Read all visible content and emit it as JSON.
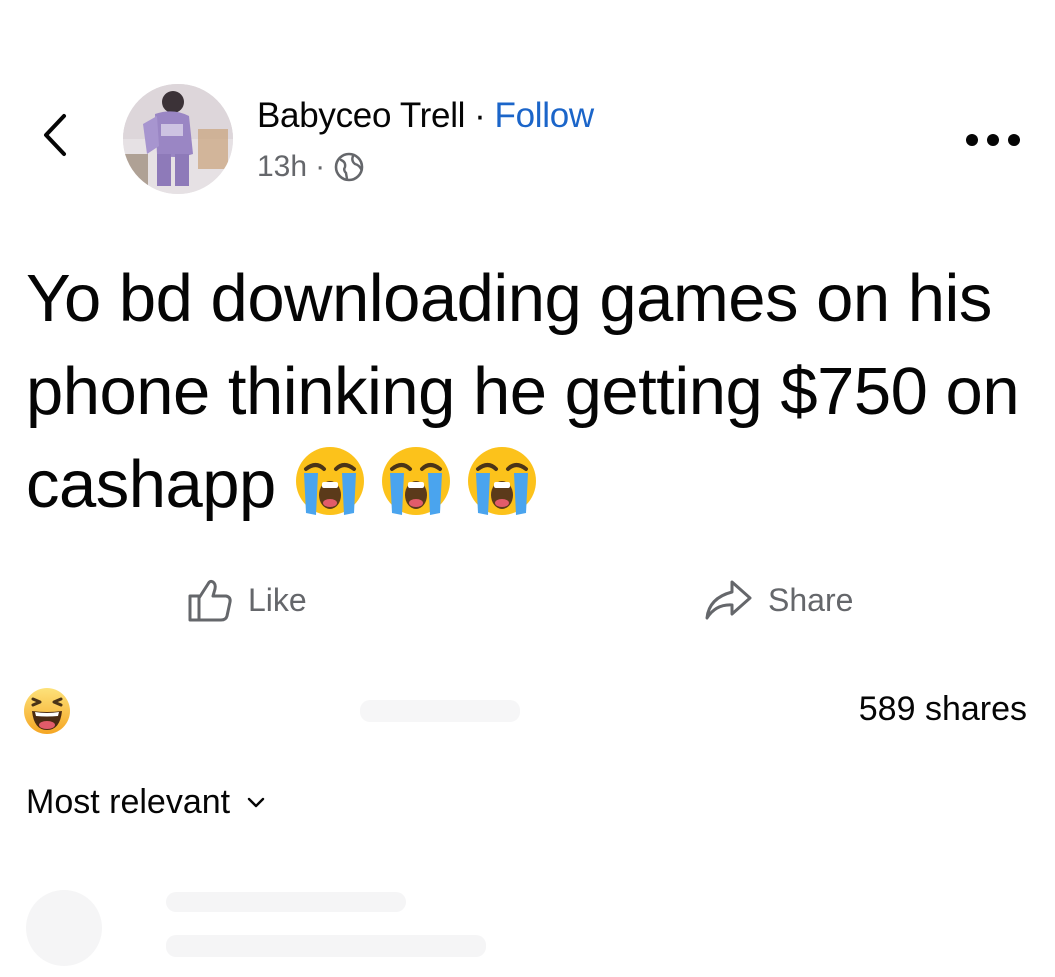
{
  "post": {
    "author": "Babyceo Trell",
    "separator": "·",
    "follow_label": "Follow",
    "time": "13h",
    "meta_separator": "·",
    "text": "Yo bd downloading games on his phone thinking he getting $750 on cashapp",
    "text_emojis": [
      "loudly-crying-face",
      "loudly-crying-face",
      "loudly-crying-face"
    ]
  },
  "icons": {
    "back": "chevron-left-icon",
    "privacy": "globe-icon",
    "more": "more-options-icon",
    "like": "thumbs-up-icon",
    "share": "share-arrow-icon",
    "reaction": "haha-reaction-icon",
    "sort": "chevron-down-icon"
  },
  "actions": {
    "like_label": "Like",
    "share_label": "Share"
  },
  "stats": {
    "shares": "589 shares"
  },
  "comments": {
    "sort_label": "Most relevant"
  },
  "colors": {
    "text": "#050505",
    "secondary": "#65676b",
    "link": "#1b65c9"
  }
}
